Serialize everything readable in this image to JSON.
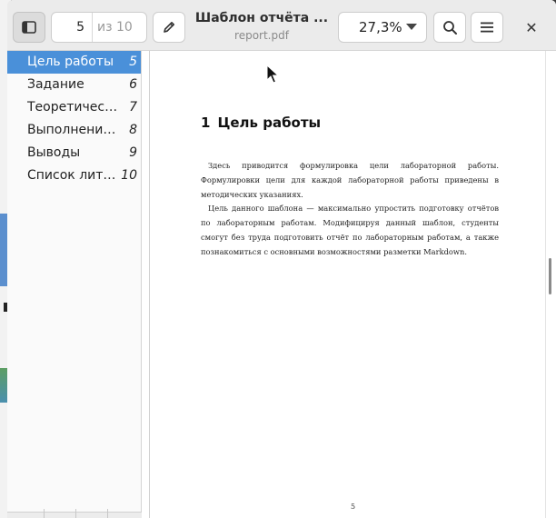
{
  "header": {
    "sidebar_toggle_icon": "sidebar-show-icon",
    "current_page": "5",
    "page_total": "из 10",
    "annotate_icon": "pencil-icon",
    "title": "Шаблон отчёта ...",
    "subtitle": "report.pdf",
    "zoom": "27,3%",
    "search_icon": "search-icon",
    "menu_icon": "hamburger-menu-icon",
    "close_label": "✕"
  },
  "sidebar": {
    "items": [
      {
        "label": "Цель работы",
        "page": "5",
        "selected": true
      },
      {
        "label": "Задание",
        "page": "6"
      },
      {
        "label": "Теоретичес…",
        "page": "7"
      },
      {
        "label": "Выполнение…",
        "page": "8"
      },
      {
        "label": "Выводы",
        "page": "9"
      },
      {
        "label": "Список лите…",
        "page": "10"
      }
    ]
  },
  "document": {
    "heading_number": "1",
    "heading_text": "Цель работы",
    "paragraphs": [
      "Здесь приводится формулировка цели лабораторной работы. Формулировки цели для каждой лабораторной работы приведены в методических указаниях.",
      "Цель данного шаблона — максимально упростить подготовку отчётов по лабораторным работам. Модифицируя данный шаблон, студенты смогут без труда подготовить отчёт по лабораторным работам, а также познакомиться с основными возможностями разметки Markdown."
    ],
    "page_number": "5"
  },
  "colors": {
    "accent": "#4a90d9",
    "headerbar": "#ebebeb"
  }
}
